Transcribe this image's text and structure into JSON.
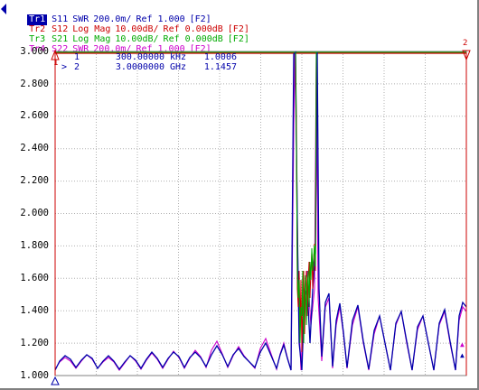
{
  "traces": [
    {
      "tag": "Tr1",
      "param": "S11",
      "format": "SWR",
      "scale": "200.0m/",
      "ref": "Ref 1.000",
      "channel": "[F2]",
      "color": "#0000aa",
      "active": true
    },
    {
      "tag": "Tr2",
      "param": "S12",
      "format": "Log Mag",
      "scale": "10.00dB/",
      "ref": "Ref 0.000dB",
      "channel": "[F2]",
      "color": "#cc0000",
      "active": false
    },
    {
      "tag": "Tr3",
      "param": "S21",
      "format": "Log Mag",
      "scale": "10.00dB/",
      "ref": "Ref 0.000dB",
      "channel": "[F2]",
      "color": "#00aa00",
      "active": false
    },
    {
      "tag": "Tr4",
      "param": "S22",
      "format": "SWR",
      "scale": "200.0m/",
      "ref": "Ref 1.000",
      "channel": "[F2]",
      "color": "#cc00cc",
      "active": false
    }
  ],
  "y_axis_labels": [
    "3.000",
    "2.800",
    "2.600",
    "2.400",
    "2.200",
    "2.000",
    "1.800",
    "1.600",
    "1.400",
    "1.200",
    "1.000"
  ],
  "markers": [
    {
      "symbol": "",
      "number": "1",
      "frequency": "300.00000",
      "unit": "kHz",
      "value": "1.0006"
    },
    {
      "symbol": ">",
      "number": "2",
      "frequency": "3.0000000",
      "unit": "GHz",
      "value": "1.1457"
    }
  ],
  "plot_markers": [
    {
      "label": "1",
      "color": "#cc0000"
    },
    {
      "label": "2",
      "color": "#cc0000"
    }
  ],
  "icons": {
    "active_trace": "left-triangle-icon",
    "marker": "triangle-marker-icon"
  }
}
